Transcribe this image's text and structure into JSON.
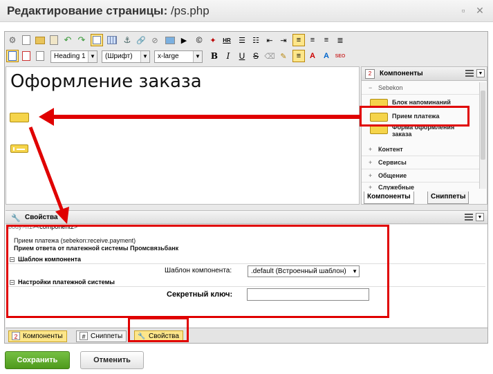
{
  "window": {
    "title_bold": "Редактирование страницы",
    "title_path": "/ps.php",
    "minimize_icon": "▫",
    "close_icon": "✕"
  },
  "toolbar": {
    "block_format": "Heading 1",
    "font_family": "(Шрифт)",
    "font_size": "x-large",
    "bold": "B",
    "italic": "I",
    "underline": "U",
    "strike": "S",
    "hr": "HR",
    "seo": "SEO"
  },
  "content": {
    "heading": "Оформление заказа"
  },
  "components_panel": {
    "title": "Компоненты",
    "root": "Sebekon",
    "items": [
      "Блок напоминаний",
      "Прием платежа",
      "Форма оформления заказа"
    ],
    "groups": [
      "Контент",
      "Сервисы",
      "Общение",
      "Служебные"
    ],
    "tabs": [
      "Компоненты",
      "Сниппеты"
    ]
  },
  "properties": {
    "title": "Свойства",
    "breadcrumb_prefix": "body>",
    "breadcrumb_h1": "h1",
    "breadcrumb_tail": "><component2>",
    "component_line": "Прием платежа (sebekon:receive.payment)",
    "component_desc": "Прием ответа от платежной системы Промсвязьбанк",
    "section_template": "Шаблон компонента",
    "template_label": "Шаблон компонента:",
    "template_value": ".default (Встроенный шаблон)",
    "section_payment": "Настройки платежной системы",
    "secret_label": "Секретный ключ:",
    "secret_value": ""
  },
  "bottom_tabs": [
    "Компоненты",
    "Сниппеты",
    "Свойства"
  ],
  "buttons": {
    "save": "Сохранить",
    "cancel": "Отменить"
  },
  "colors": {
    "highlight": "#e00000",
    "save_green": "#5aa428",
    "placeholder_yellow": "#f5d44a"
  }
}
